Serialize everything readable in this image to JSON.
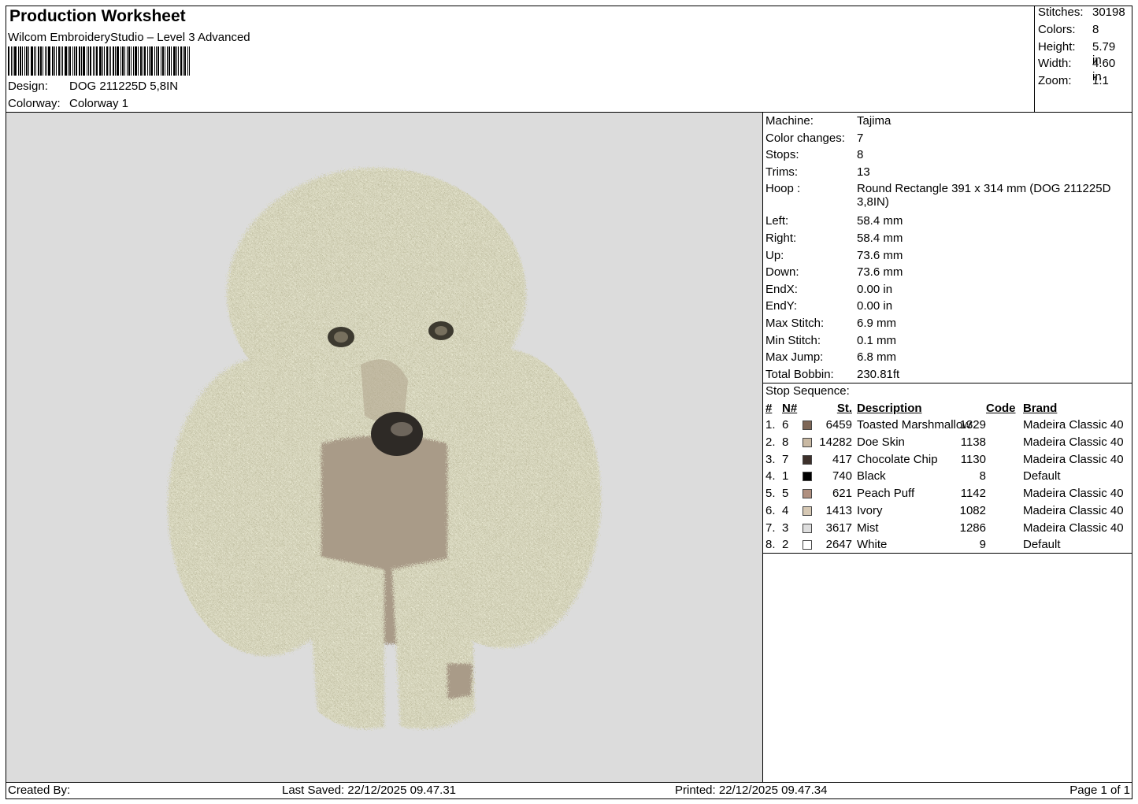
{
  "header": {
    "title": "Production Worksheet",
    "software": "Wilcom EmbroideryStudio – Level 3 Advanced",
    "design_label": "Design:",
    "design_value": "DOG 211225D 5,8IN",
    "colorway_label": "Colorway:",
    "colorway_value": "Colorway 1"
  },
  "stats": [
    {
      "label": "Stitches:",
      "value": "30198"
    },
    {
      "label": "Colors:",
      "value": "8"
    },
    {
      "label": "Height:",
      "value": "5.79 in"
    },
    {
      "label": "Width:",
      "value": "4.60 in"
    },
    {
      "label": "Zoom:",
      "value": "1:1"
    }
  ],
  "machine_info": [
    {
      "label": "Machine:",
      "value": "Tajima"
    },
    {
      "label": "Color changes:",
      "value": "7"
    },
    {
      "label": "Stops:",
      "value": "8"
    },
    {
      "label": "Trims:",
      "value": "13"
    },
    {
      "label": "Hoop :",
      "value": "Round Rectangle 391 x 314 mm (DOG 211225D 3,8IN)"
    },
    {
      "label": "Left:",
      "value": "58.4 mm"
    },
    {
      "label": "Right:",
      "value": "58.4 mm"
    },
    {
      "label": "Up:",
      "value": "73.6 mm"
    },
    {
      "label": "Down:",
      "value": "73.6 mm"
    },
    {
      "label": "EndX:",
      "value": "0.00 in"
    },
    {
      "label": "EndY:",
      "value": "0.00 in"
    },
    {
      "label": "Max Stitch:",
      "value": "6.9 mm"
    },
    {
      "label": "Min Stitch:",
      "value": "0.1 mm"
    },
    {
      "label": "Max Jump:",
      "value": "6.8 mm"
    },
    {
      "label": "Total Bobbin:",
      "value": "230.81ft"
    }
  ],
  "stop_sequence": {
    "title": "Stop Sequence:",
    "headers": {
      "num": "#",
      "n": "N#",
      "st": "St.",
      "desc": "Description",
      "code": "Code",
      "brand": "Brand"
    },
    "rows": [
      {
        "num": "1.",
        "n": "6",
        "color": "#7d6656",
        "st": "6459",
        "desc": "Toasted Marshmallow",
        "code": "1329",
        "brand": "Madeira Classic 40"
      },
      {
        "num": "2.",
        "n": "8",
        "color": "#c9b9a3",
        "st": "14282",
        "desc": "Doe Skin",
        "code": "1138",
        "brand": "Madeira Classic 40"
      },
      {
        "num": "3.",
        "n": "7",
        "color": "#3d302b",
        "st": "417",
        "desc": "Chocolate Chip",
        "code": "1130",
        "brand": "Madeira Classic 40"
      },
      {
        "num": "4.",
        "n": "1",
        "color": "#000000",
        "st": "740",
        "desc": "Black",
        "code": "8",
        "brand": "Default"
      },
      {
        "num": "5.",
        "n": "5",
        "color": "#b09080",
        "st": "621",
        "desc": "Peach Puff",
        "code": "1142",
        "brand": "Madeira Classic 40"
      },
      {
        "num": "6.",
        "n": "4",
        "color": "#d6c8b4",
        "st": "1413",
        "desc": "Ivory",
        "code": "1082",
        "brand": "Madeira Classic 40"
      },
      {
        "num": "7.",
        "n": "3",
        "color": "#dedede",
        "st": "3617",
        "desc": "Mist",
        "code": "1286",
        "brand": "Madeira Classic 40"
      },
      {
        "num": "8.",
        "n": "2",
        "color": "#ffffff",
        "st": "2647",
        "desc": "White",
        "code": "9",
        "brand": "Default"
      }
    ]
  },
  "footer": {
    "created_by": "Created By:",
    "last_saved": "Last Saved: 22/12/2025 09.47.31",
    "printed": "Printed: 22/12/2025 09.47.34",
    "page": "Page 1 of 1"
  }
}
